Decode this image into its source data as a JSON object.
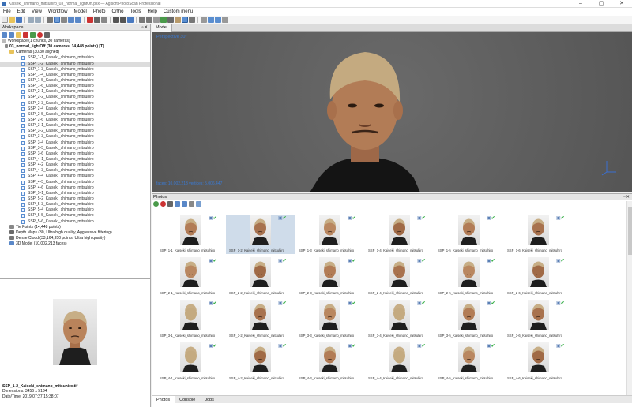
{
  "window": {
    "title": "Kaiseki_shimano_mitsuhiro_03_normal_lightOff.psx — Agisoft PhotoScan Professional"
  },
  "menu": [
    "File",
    "Edit",
    "View",
    "Workflow",
    "Model",
    "Photo",
    "Ortho",
    "Tools",
    "Help",
    "Custom menu"
  ],
  "workspace": {
    "title": "Workspace",
    "root": "Workspace (1 chunks, 30 cameras)",
    "chunk": "03_normal_lightOff (30 cameras, 14,448 points) [T]",
    "cameras_group": "Cameras (30/30 aligned)",
    "cameras": [
      "SSP_1-1_Kaiseki_shimano_mitsuhiro",
      "SSP_1-2_Kaiseki_shimano_mitsuhiro",
      "SSP_1-3_Kaiseki_shimano_mitsuhiro",
      "SSP_1-4_Kaiseki_shimano_mitsuhiro",
      "SSP_1-5_Kaiseki_shimano_mitsuhiro",
      "SSP_1-6_Kaiseki_shimano_mitsuhiro",
      "SSP_2-1_Kaiseki_shimano_mitsuhiro",
      "SSP_2-2_Kaiseki_shimano_mitsuhiro",
      "SSP_2-3_Kaiseki_shimano_mitsuhiro",
      "SSP_2-4_Kaiseki_shimano_mitsuhiro",
      "SSP_2-5_Kaiseki_shimano_mitsuhiro",
      "SSP_2-6_Kaiseki_shimano_mitsuhiro",
      "SSP_3-1_Kaiseki_shimano_mitsuhiro",
      "SSP_3-2_Kaiseki_shimano_mitsuhiro",
      "SSP_3-3_Kaiseki_shimano_mitsuhiro",
      "SSP_3-4_Kaiseki_shimano_mitsuhiro",
      "SSP_3-5_Kaiseki_shimano_mitsuhiro",
      "SSP_3-6_Kaiseki_shimano_mitsuhiro",
      "SSP_4-1_Kaiseki_shimano_mitsuhiro",
      "SSP_4-2_Kaiseki_shimano_mitsuhiro",
      "SSP_4-3_Kaiseki_shimano_mitsuhiro",
      "SSP_4-4_Kaiseki_shimano_mitsuhiro",
      "SSP_4-5_Kaiseki_shimano_mitsuhiro",
      "SSP_4-6_Kaiseki_shimano_mitsuhiro",
      "SSP_5-1_Kaiseki_shimano_mitsuhiro",
      "SSP_5-2_Kaiseki_shimano_mitsuhiro",
      "SSP_5-3_Kaiseki_shimano_mitsuhiro",
      "SSP_5-4_Kaiseki_shimano_mitsuhiro",
      "SSP_5-5_Kaiseki_shimano_mitsuhiro",
      "SSP_5-6_Kaiseki_shimano_mitsuhiro"
    ],
    "selected_camera": 1,
    "tie_points": "Tie Points (14,448 points)",
    "depth_maps": "Depth Maps (30, Ultra high quality, Aggressive filtering)",
    "dense_cloud": "Dense Cloud (33,164,950 points, Ultra high quality)",
    "model_3d": "3D Model (10,002,213 faces)"
  },
  "preview": {
    "filename": "SSP_1-2_Kaiseki_shimano_mitsuhiro.tif",
    "dimensions": "Dimensions: 3456 x 5184",
    "datetime": "Date/Time: 2019:07:27 15:38:07"
  },
  "model": {
    "tab": "Model",
    "perspective": "Perspective 30°",
    "stats": "faces: 10,002,213 vertices: 5,006,447"
  },
  "photos": {
    "title": "Photos",
    "selected_index": 1,
    "items": [
      "SSP_1-1_Kaiseki_shimano_mitsuhiro",
      "SSP_1-2_Kaiseki_shimano_mitsuhiro",
      "SSP_1-3_Kaiseki_shimano_mitsuhiro",
      "SSP_1-4_Kaiseki_shimano_mitsuhiro",
      "SSP_1-5_Kaiseki_shimano_mitsuhiro",
      "SSP_1-6_Kaiseki_shimano_mitsuhiro",
      "SSP_2-1_Kaiseki_shimano_mitsuhiro",
      "SSP_2-2_Kaiseki_shimano_mitsuhiro",
      "SSP_2-3_Kaiseki_shimano_mitsuhiro",
      "SSP_2-4_Kaiseki_shimano_mitsuhiro",
      "SSP_2-5_Kaiseki_shimano_mitsuhiro",
      "SSP_2-6_Kaiseki_shimano_mitsuhiro",
      "SSP_3-1_Kaiseki_shimano_mitsuhiro",
      "SSP_3-2_Kaiseki_shimano_mitsuhiro",
      "SSP_3-3_Kaiseki_shimano_mitsuhiro",
      "SSP_3-4_Kaiseki_shimano_mitsuhiro",
      "SSP_3-5_Kaiseki_shimano_mitsuhiro",
      "SSP_3-6_Kaiseki_shimano_mitsuhiro",
      "SSP_4-1_Kaiseki_shimano_mitsuhiro",
      "SSP_4-2_Kaiseki_shimano_mitsuhiro",
      "SSP_4-3_Kaiseki_shimano_mitsuhiro",
      "SSP_4-4_Kaiseki_shimano_mitsuhiro",
      "SSP_4-5_Kaiseki_shimano_mitsuhiro",
      "SSP_4-6_Kaiseki_shimano_mitsuhiro"
    ]
  },
  "bottom_tabs": [
    "Photos",
    "Console",
    "Jobs"
  ],
  "colors": {
    "accent": "#3a7bd6",
    "aligned_check": "#3ab04a",
    "model_bg": "#5c5c5c"
  }
}
